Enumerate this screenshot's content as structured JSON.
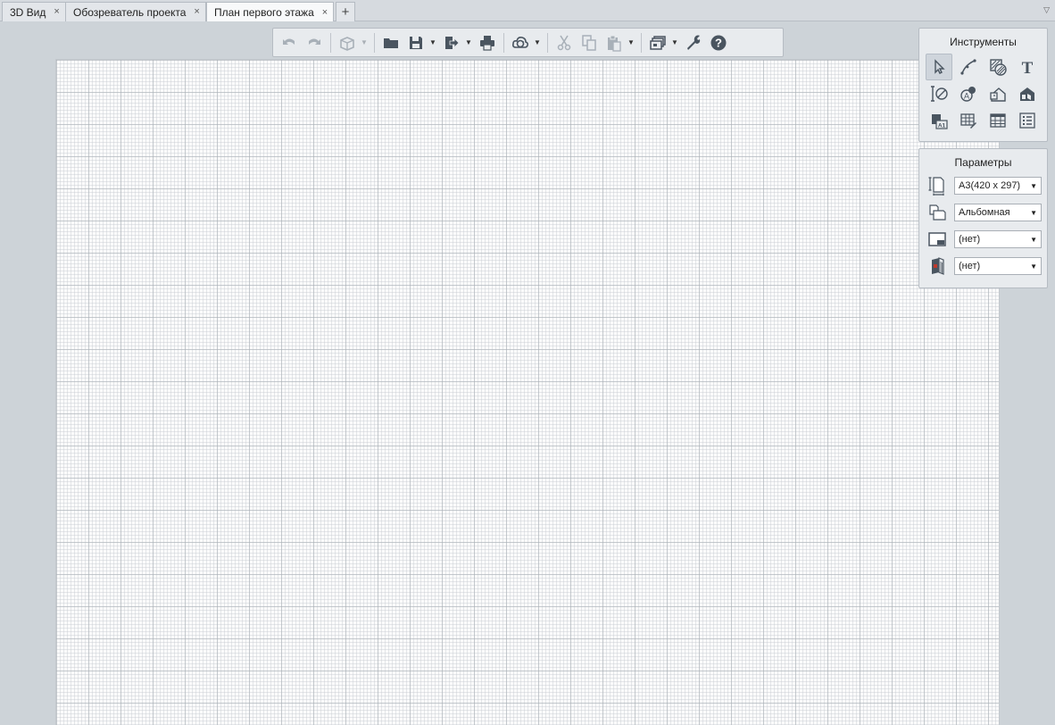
{
  "tabs": [
    {
      "label": "3D Вид",
      "close": "×"
    },
    {
      "label": "Обозреватель проекта",
      "close": "×"
    },
    {
      "label": "План первого этажа",
      "close": "×",
      "active": true
    }
  ],
  "tab_add": "+",
  "tab_menu": "▽",
  "toolbar": {
    "caret": "▼"
  },
  "tools_panel": {
    "title": "Инструменты",
    "text_tool_glyph": "T"
  },
  "params_panel": {
    "title": "Параметры",
    "paper_size": "A3(420 x 297)",
    "orientation": "Альбомная",
    "frame": "(нет)",
    "stamp": "(нет)",
    "arrow": "▼"
  },
  "colors": {
    "icon": "#4a5560",
    "icon_disabled": "#a8b0b8",
    "background": "#cdd3d8",
    "sheet": "#fbfbfb"
  }
}
